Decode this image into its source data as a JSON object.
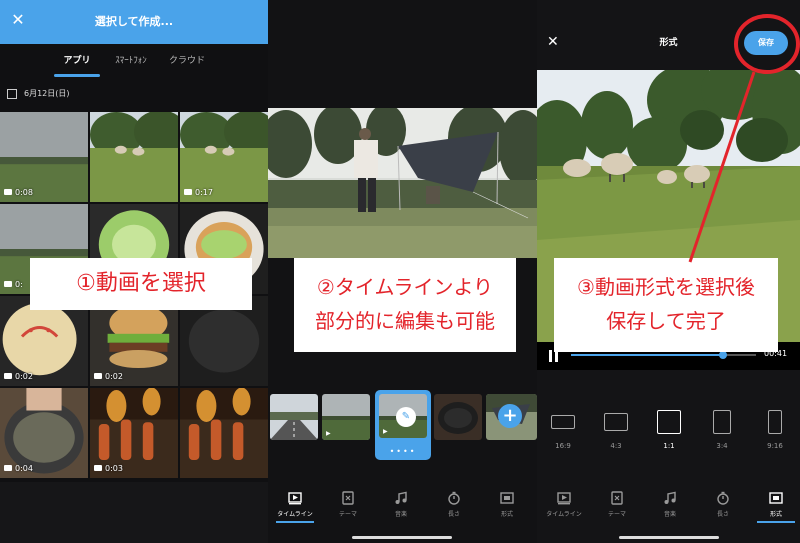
{
  "panel1": {
    "title": "選択して作成...",
    "tabs": [
      {
        "label": "アプリ",
        "active": true
      },
      {
        "label": "ｽﾏｰﾄﾌｫﾝ",
        "active": false
      },
      {
        "label": "クラウド",
        "active": false
      }
    ],
    "date_label": "6月12日(日)",
    "thumbnails": [
      {
        "scene": "field-overcast",
        "duration": "0:08"
      },
      {
        "scene": "sheep-field",
        "duration": ""
      },
      {
        "scene": "sheep-field",
        "duration": "0:17"
      },
      {
        "scene": "field-overcast",
        "duration": "0:"
      },
      {
        "scene": "cabbage",
        "duration": ""
      },
      {
        "scene": "cabbage-plate",
        "duration": ""
      },
      {
        "scene": "pancake",
        "duration": "0:02"
      },
      {
        "scene": "burger",
        "duration": "0:02"
      },
      {
        "scene": "burger-dark",
        "duration": ""
      },
      {
        "scene": "pot",
        "duration": "0:04"
      },
      {
        "scene": "grill",
        "duration": "0:03"
      },
      {
        "scene": "grill",
        "duration": ""
      }
    ]
  },
  "panel2": {
    "timeline_clips": [
      {
        "scene": "road"
      },
      {
        "scene": "field-overcast"
      },
      {
        "scene": "field-overcast",
        "selected": true
      },
      {
        "scene": "pan"
      },
      {
        "scene": "tent"
      }
    ],
    "selected_dots": "••••",
    "add_label": "+",
    "nav": [
      {
        "label": "タイムライン",
        "icon": "timeline-icon",
        "active": true
      },
      {
        "label": "テーマ",
        "icon": "theme-icon",
        "active": false
      },
      {
        "label": "音楽",
        "icon": "music-icon",
        "active": false
      },
      {
        "label": "長さ",
        "icon": "timer-icon",
        "active": false
      },
      {
        "label": "形式",
        "icon": "format-icon",
        "active": false
      }
    ]
  },
  "panel3": {
    "title": "形式",
    "save_label": "保存",
    "time": "00:41",
    "progress": 0.82,
    "ratios": [
      {
        "label": "16:9",
        "w": 16,
        "h": 9,
        "active": false
      },
      {
        "label": "4:3",
        "w": 4,
        "h": 3,
        "active": false
      },
      {
        "label": "1:1",
        "w": 1,
        "h": 1,
        "active": true
      },
      {
        "label": "3:4",
        "w": 3,
        "h": 4,
        "active": false
      },
      {
        "label": "9:16",
        "w": 9,
        "h": 16,
        "active": false
      }
    ],
    "nav": [
      {
        "label": "タイムライン",
        "icon": "timeline-icon",
        "active": false
      },
      {
        "label": "テーマ",
        "icon": "theme-icon",
        "active": false
      },
      {
        "label": "音楽",
        "icon": "music-icon",
        "active": false
      },
      {
        "label": "長さ",
        "icon": "timer-icon",
        "active": false
      },
      {
        "label": "形式",
        "icon": "format-icon",
        "active": true
      }
    ]
  },
  "callouts": {
    "c1": "①動画を選択",
    "c2_line1": "②タイムラインより",
    "c2_line2": "部分的に編集も可能",
    "c3_line1": "③動画形式を選択後",
    "c3_line2": "保存して完了"
  },
  "colors": {
    "accent": "#4aa3ea",
    "annotation": "#e3242b"
  }
}
